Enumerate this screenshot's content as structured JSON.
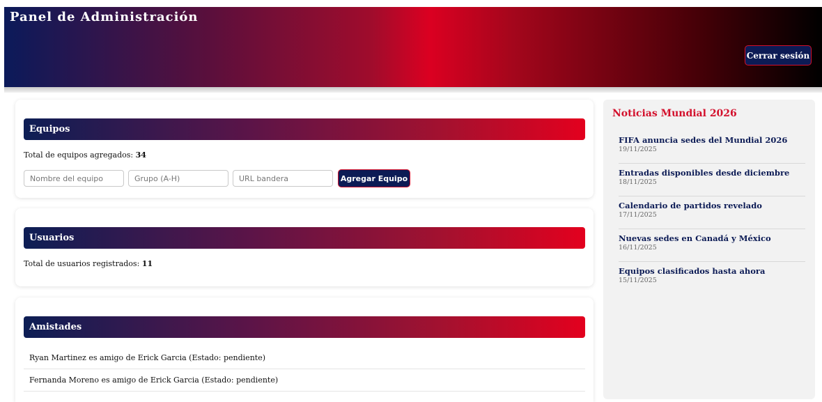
{
  "header": {
    "title": "Panel de Administración",
    "logout_label": "Cerrar sesión"
  },
  "equipos": {
    "title": "Equipos",
    "total_label": "Total de equipos agregados:",
    "total_value": "34",
    "fields": {
      "name_placeholder": "Nombre del equipo",
      "group_placeholder": "Grupo (A-H)",
      "flag_placeholder": "URL bandera"
    },
    "add_label": "Agregar Equipo"
  },
  "usuarios": {
    "title": "Usuarios",
    "total_label": "Total de usuarios registrados:",
    "total_value": "11"
  },
  "amistades": {
    "title": "Amistades",
    "items": [
      "Ryan Martinez es amigo de Erick Garcia (Estado: pendiente)",
      "Fernanda Moreno es amigo de Erick Garcia (Estado: pendiente)"
    ]
  },
  "news": {
    "title": "Noticias Mundial 2026",
    "items": [
      {
        "headline": "FIFA anuncia sedes del Mundial 2026",
        "date": "19/11/2025"
      },
      {
        "headline": "Entradas disponibles desde diciembre",
        "date": "18/11/2025"
      },
      {
        "headline": "Calendario de partidos revelado",
        "date": "17/11/2025"
      },
      {
        "headline": "Nuevas sedes en Canadá y México",
        "date": "16/11/2025"
      },
      {
        "headline": "Equipos clasificados hasta ahora",
        "date": "15/11/2025"
      }
    ]
  },
  "colors": {
    "brand_navy": "#0c1b55",
    "brand_red": "#d3102c"
  }
}
